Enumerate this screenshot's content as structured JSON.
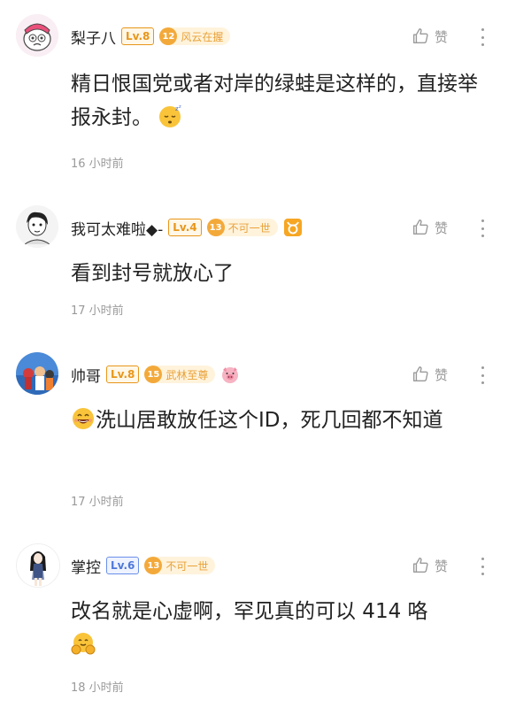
{
  "comments": [
    {
      "username": "梨子八",
      "level": "Lv.8",
      "fan_level": "12",
      "fan_title": "风云在握",
      "text": "精日恨国党或者对岸的绿蛙是这样的，直接举报永封。",
      "time": "16 小时前",
      "like_label": "赞",
      "emoji": "sleeping-emoji"
    },
    {
      "username": "我可太难啦◆-",
      "level": "Lv.4",
      "fan_level": "13",
      "fan_title": "不可一世",
      "text": "看到封号就放心了",
      "time": "17 小时前",
      "like_label": "赞",
      "decoration": "taurus-badge-icon"
    },
    {
      "username": "帅哥",
      "level": "Lv.8",
      "fan_level": "15",
      "fan_title": "武林至尊",
      "text": "洗山居敢放任这个ID，死几回都不知道",
      "time": "17 小时前",
      "like_label": "赞",
      "emoji": "grinning-emoji",
      "decoration": "pig-icon"
    },
    {
      "username": "掌控",
      "level": "Lv.6",
      "fan_level": "13",
      "fan_title": "不可一世",
      "text": "改名就是心虚啊，罕见真的可以 414 咯",
      "time": "18 小时前",
      "like_label": "赞",
      "emoji": "fist-hands-emoji"
    }
  ],
  "colors": {
    "lv8": "#f0a020",
    "lv4": "#f0a020",
    "lv6": "#6a8fe8",
    "fan_gold": "#f7b84a",
    "fan_bg": "#fff3dc",
    "fan_text": "#e8a23a",
    "muted": "#9a9a9a"
  }
}
